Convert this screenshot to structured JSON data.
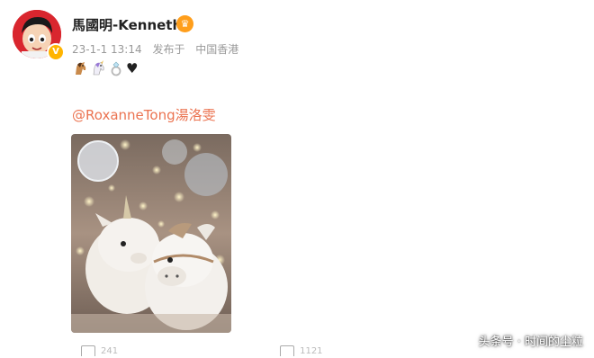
{
  "post": {
    "author": "馬國明-Kenneth",
    "date": "23-1-1 13:14",
    "source": "发布于",
    "location": "中国香港",
    "mention": "@RoxanneTong湯洛雯",
    "emoji_row": [
      "horse-emoji",
      "unicorn-emoji",
      "ring-emoji",
      "black-heart-emoji"
    ],
    "heart_glyph": "♥",
    "verified_glyph": "V",
    "photo_description_icon": "unicorn-horse-plush-photo"
  },
  "actions": {
    "share_count": "241",
    "comment_count": "1121"
  },
  "watermark": "头条号 · 时间的尘粒",
  "colors": {
    "mention": "#eb7350",
    "meta": "#999999",
    "verified": "#ffb400"
  }
}
